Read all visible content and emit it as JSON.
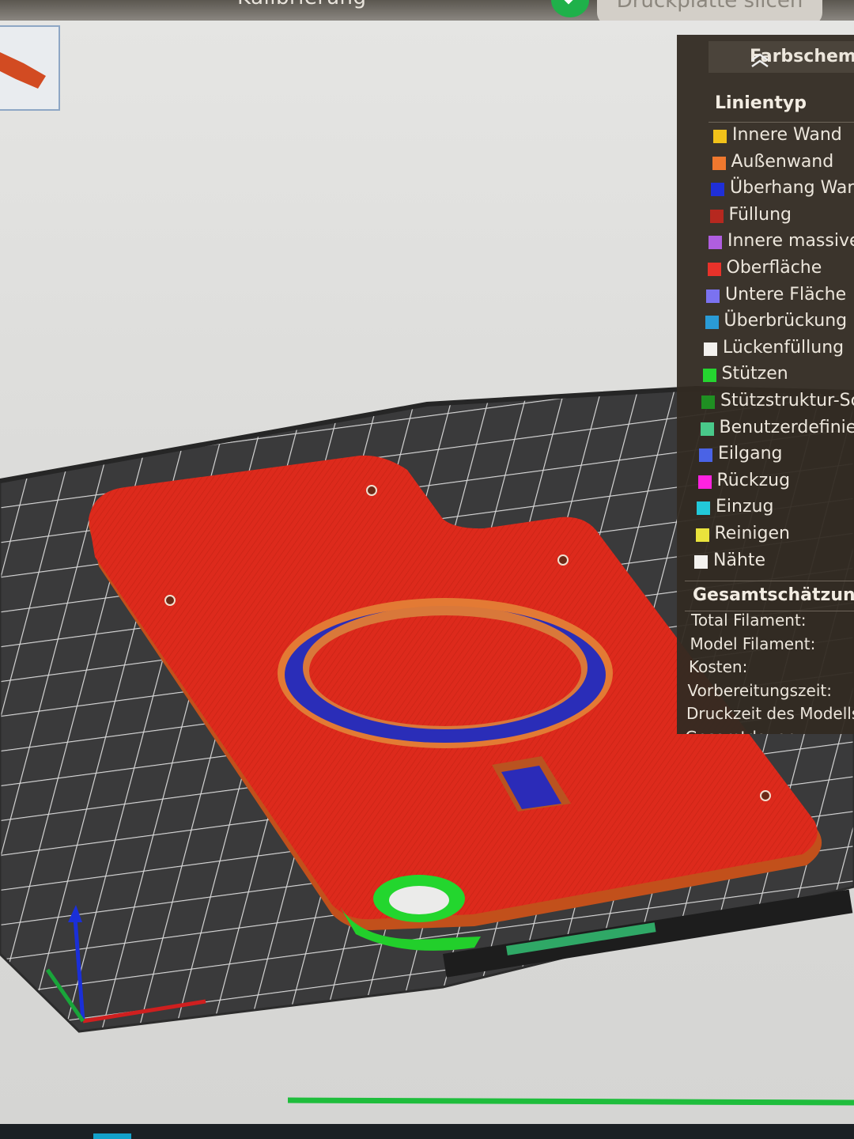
{
  "toolbar": {
    "calibration_label": "Kalibrierung",
    "slice_label": "Druckplatte slicen"
  },
  "legend": {
    "title": "Farbschema",
    "section_title": "Linientyp",
    "items": [
      {
        "label": "Innere Wand",
        "color": "#f2c21a"
      },
      {
        "label": "Außenwand",
        "color": "#f0782e"
      },
      {
        "label": "Überhang Wan",
        "color": "#1f2fd8"
      },
      {
        "label": "Füllung",
        "color": "#b6281f"
      },
      {
        "label": "Innere massive",
        "color": "#b05ee0"
      },
      {
        "label": "Oberfläche",
        "color": "#e8322a"
      },
      {
        "label": "Untere Fläche",
        "color": "#7b72f0"
      },
      {
        "label": "Überbrückung",
        "color": "#2a9bd6"
      },
      {
        "label": "Lückenfüllung",
        "color": "#f3f1ee"
      },
      {
        "label": "Stützen",
        "color": "#25d530"
      },
      {
        "label": "Stützstruktur-Sc",
        "color": "#1f8f22"
      },
      {
        "label": "Benutzerdefinie",
        "color": "#49c98a"
      },
      {
        "label": "Eilgang",
        "color": "#4a63e6"
      },
      {
        "label": "Rückzug",
        "color": "#ff22e0"
      },
      {
        "label": "Einzug",
        "color": "#22c9d9"
      },
      {
        "label": "Reinigen",
        "color": "#e9e33c"
      },
      {
        "label": "Nähte",
        "color": "#f4f2ef"
      }
    ],
    "estimate_title": "Gesamtschätzung",
    "estimates": [
      "Total Filament:",
      "Model Filament:",
      "Kosten:",
      "Vorbereitungszeit:",
      "Druckzeit des Modells",
      "Gesamtdauer:"
    ]
  },
  "icons": {
    "collapse": "chevron-double-up-icon",
    "check": "check-icon"
  }
}
